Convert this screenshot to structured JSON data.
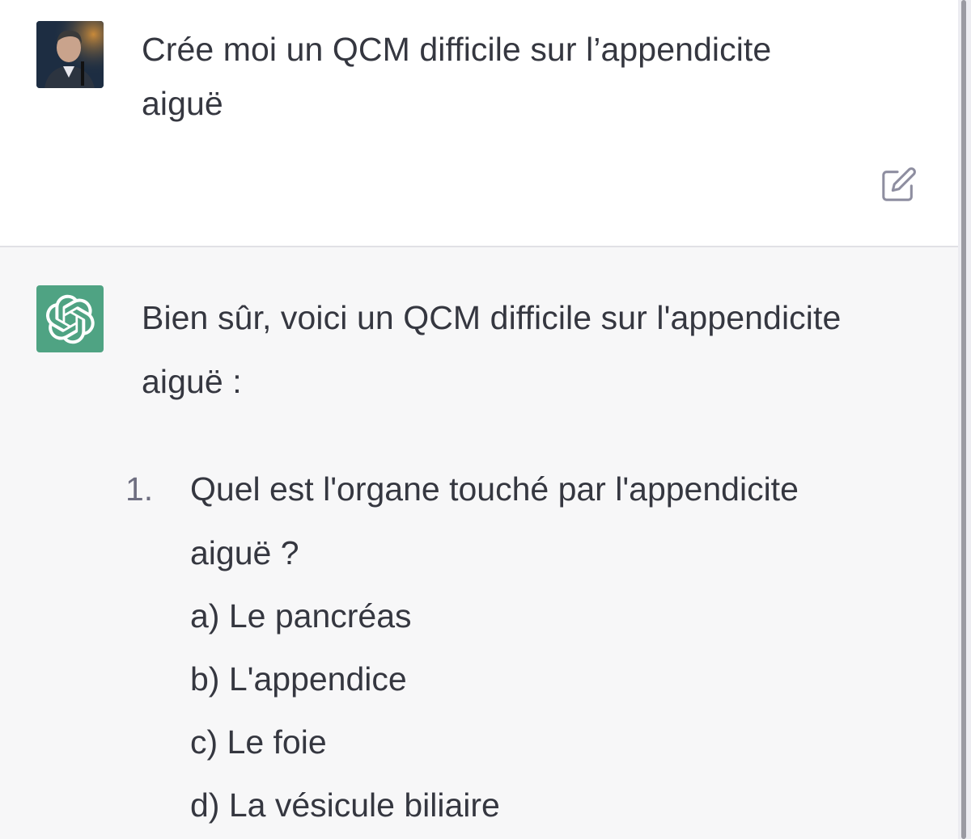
{
  "user_message": {
    "line1": "Crée moi un QCM difficile sur l’appendicite",
    "line2": "aiguë"
  },
  "assistant_message": {
    "intro_line1": "Bien sûr, voici un QCM difficile sur l'appendicite",
    "intro_line2": "aiguë :",
    "questions": [
      {
        "number": "1.",
        "text_line1": "Quel est l'organe touché par l'appendicite",
        "text_line2": "aiguë ?",
        "options": [
          "a) Le pancréas",
          "b) L'appendice",
          "c) Le foie",
          "d) La vésicule biliaire"
        ]
      }
    ]
  },
  "icons": {
    "edit": "edit-icon",
    "bot_logo": "openai-logo-icon",
    "user_avatar": "user-avatar-photo"
  },
  "colors": {
    "bot_avatar_bg": "#4fa383",
    "assistant_bg": "#f7f7f8",
    "text": "#353740"
  }
}
